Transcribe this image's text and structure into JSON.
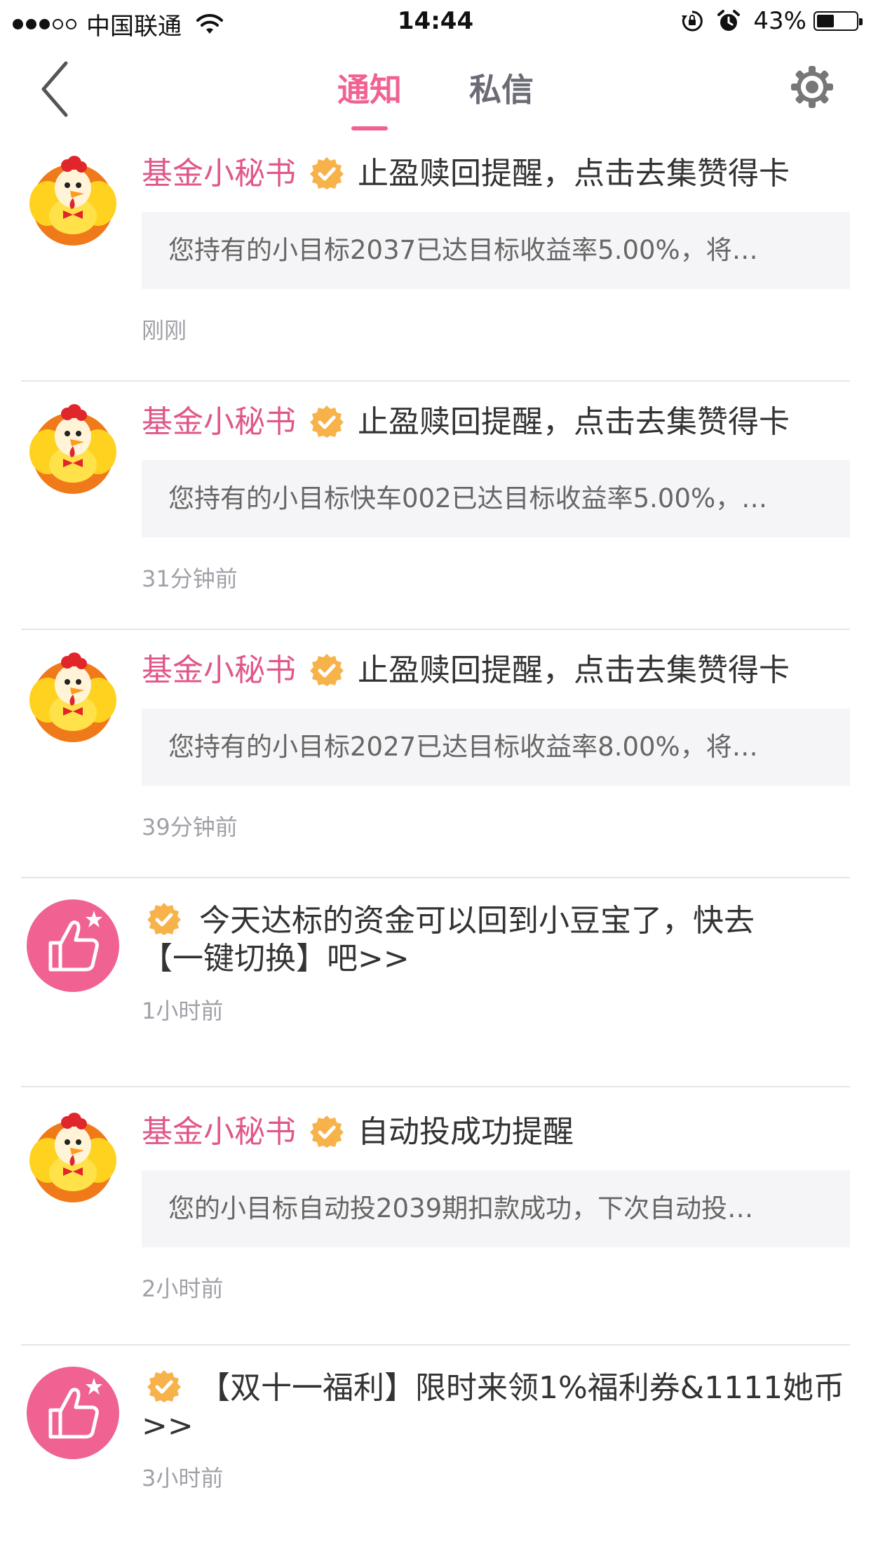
{
  "status_bar": {
    "carrier": "中国联通",
    "time": "14:44",
    "battery": "43%",
    "battery_level": 0.43,
    "icons": [
      "signal-dots",
      "wifi-icon",
      "rotation-lock-icon",
      "alarm-icon",
      "battery-icon"
    ]
  },
  "nav": {
    "back_icon": "chevron-left-icon",
    "tabs": [
      {
        "label": "通知",
        "active": true
      },
      {
        "label": "私信",
        "active": false
      }
    ],
    "settings_icon": "gear-icon"
  },
  "colors": {
    "accent": "#f06292",
    "sender": "#e0578a",
    "badge": "#f7b24a",
    "preview_bg": "#f5f5f7"
  },
  "items": [
    {
      "type": "notice",
      "avatar_icon": "rooster-mascot-icon",
      "sender": "基金小秘书",
      "subject": "止盈赎回提醒，点击去集赞得卡",
      "preview": "您持有的小目标2037已达目标收益率5.00%，将…",
      "time": "刚刚"
    },
    {
      "type": "notice",
      "avatar_icon": "rooster-mascot-icon",
      "sender": "基金小秘书",
      "subject": "止盈赎回提醒，点击去集赞得卡",
      "preview": "您持有的小目标快车002已达目标收益率5.00%，…",
      "time": "31分钟前"
    },
    {
      "type": "notice",
      "avatar_icon": "rooster-mascot-icon",
      "sender": "基金小秘书",
      "subject": "止盈赎回提醒，点击去集赞得卡",
      "preview": "您持有的小目标2027已达目标收益率8.00%，将…",
      "time": "39分钟前"
    },
    {
      "type": "promo",
      "avatar_icon": "thumbs-up-star-icon",
      "line1": "今天达标的资金可以回到小豆宝了，快去",
      "line2": "【一键切换】吧>>",
      "time": "1小时前"
    },
    {
      "type": "notice",
      "avatar_icon": "rooster-mascot-icon",
      "sender": "基金小秘书",
      "subject": "自动投成功提醒",
      "preview": "您的小目标自动投2039期扣款成功，下次自动投…",
      "time": "2小时前"
    },
    {
      "type": "promo",
      "avatar_icon": "thumbs-up-star-icon",
      "line1": "【双十一福利】限时来领1%福利券&1111她币",
      "line2": ">>",
      "time": "3小时前"
    }
  ]
}
